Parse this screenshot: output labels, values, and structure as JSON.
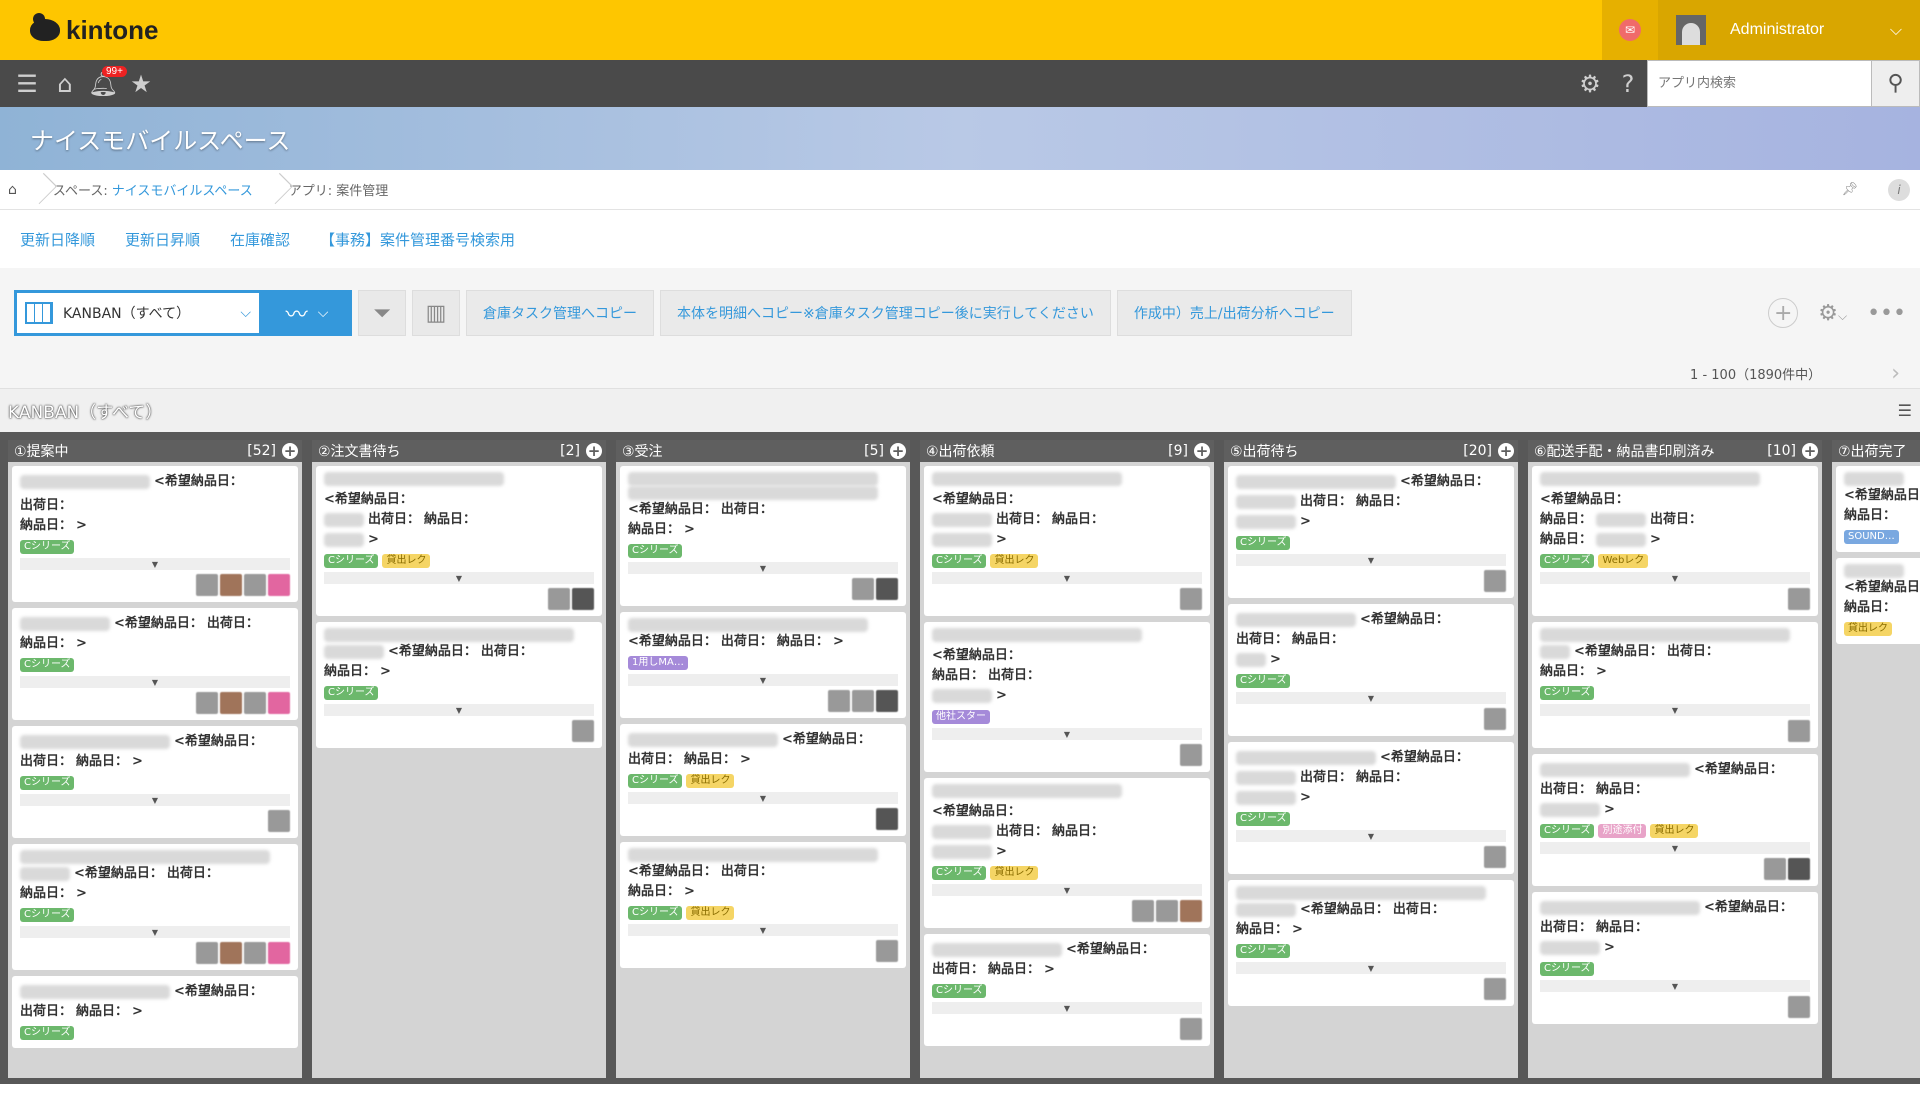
{
  "topbar": {
    "logo": "kintone",
    "user_name": "Administrator"
  },
  "nav": {
    "badge": "99+",
    "search_placeholder": "アプリ内検索"
  },
  "space": {
    "title": "ナイスモバイルスペース"
  },
  "breadcrumb": {
    "space_label": "スペース:",
    "space_name": "ナイスモバイルスペース",
    "app_label": "アプリ: 案件管理"
  },
  "tabs": [
    "更新日降順",
    "更新日昇順",
    "在庫確認",
    "【事務】案件管理番号検索用"
  ],
  "toolbar": {
    "view_name": "KANBAN（すべて）",
    "actions": [
      "倉庫タスク管理へコピー",
      "本体を明細へコピー※倉庫タスク管理コピー後に実行してください",
      "作成中）売上/出荷分析へコピー"
    ]
  },
  "pager": {
    "range": "1 - 100",
    "total": "（1890件中）"
  },
  "view_title": "KANBAN（すべて）",
  "labels": {
    "desired": "<希望納品日：",
    "ship": "出荷日：",
    "deliver": "納品日：",
    "close": ">"
  },
  "columns": [
    {
      "title": "①提案中",
      "count": "[52]"
    },
    {
      "title": "②注文書待ち",
      "count": "[2]"
    },
    {
      "title": "③受注",
      "count": "[5]"
    },
    {
      "title": "④出荷依頼",
      "count": "[9]"
    },
    {
      "title": "⑤出荷待ち",
      "count": "[20]"
    },
    {
      "title": "⑥配送手配・納品書印刷済み",
      "count": "[10]"
    },
    {
      "title": "⑦出荷完了",
      "count": ""
    }
  ],
  "tags": {
    "series": "Cシリーズ",
    "rental": "貸出レク",
    "web": "Webレク",
    "ma": "1用しMA…",
    "other": "他社スター",
    "sound": "SOUND…",
    "misc": "別途添付"
  }
}
